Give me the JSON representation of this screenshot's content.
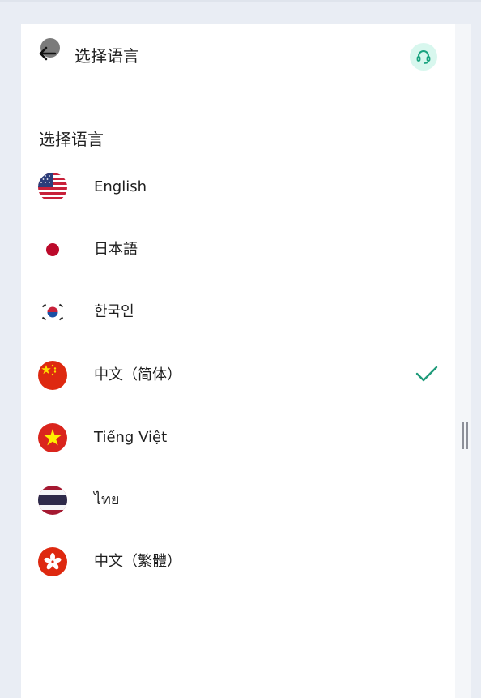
{
  "header": {
    "title": "选择语言",
    "back_icon": "arrow-left-icon",
    "support_icon": "headset-icon",
    "accent_color": "#1aa37f"
  },
  "section": {
    "title": "选择语言"
  },
  "languages": [
    {
      "label": "English",
      "flag": "us-flag-icon",
      "selected": false
    },
    {
      "label": "日本語",
      "flag": "japan-flag-icon",
      "selected": false
    },
    {
      "label": "한국인",
      "flag": "korea-flag-icon",
      "selected": false
    },
    {
      "label": "中文（简体）",
      "flag": "china-flag-icon",
      "selected": true
    },
    {
      "label": "Tiếng Việt",
      "flag": "vietnam-flag-icon",
      "selected": false
    },
    {
      "label": "ไทย",
      "flag": "thailand-flag-icon",
      "selected": false
    },
    {
      "label": "中文（繁體）",
      "flag": "hong-kong-flag-icon",
      "selected": false
    }
  ]
}
